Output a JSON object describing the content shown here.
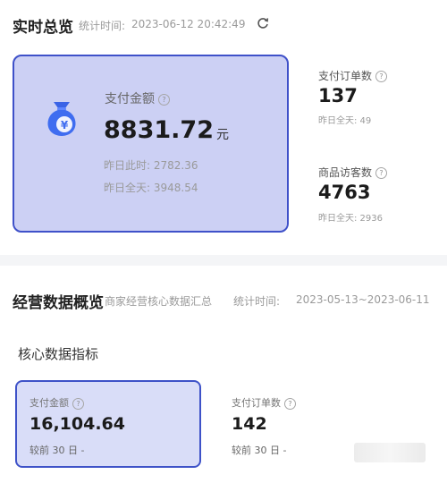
{
  "realtime": {
    "title": "实时总览",
    "stat_time_label": "统计时间:",
    "stat_time": "2023-06-12 20:42:49"
  },
  "main_card": {
    "label": "支付金额",
    "value": "8831.72",
    "unit": "元",
    "yesterday_same_time": "昨日此时: 2782.36",
    "yesterday_all_day": "昨日全天: 3948.54"
  },
  "side_metrics": [
    {
      "label": "支付订单数",
      "value": "137",
      "sub": "昨日全天: 49"
    },
    {
      "label": "商品访客数",
      "value": "4763",
      "sub": "昨日全天: 2936"
    }
  ],
  "overview": {
    "title": "经营数据概览",
    "description": "商家经营核心数据汇总",
    "stat_time_label": "统计时间:",
    "date_range": "2023-05-13~2023-06-11"
  },
  "core": {
    "title": "核心数据指标",
    "metrics": [
      {
        "label": "支付金额",
        "value": "16,104.64",
        "compare": "较前 30 日 -"
      },
      {
        "label": "支付订单数",
        "value": "142",
        "compare": "较前 30 日 -"
      }
    ]
  },
  "icons": {
    "question": "question-circle-icon",
    "refresh": "refresh-icon",
    "money_bag": "money-bag-icon"
  },
  "colors": {
    "accent": "#3f51c9",
    "card_bg": "#ccd0f4",
    "card2_bg": "#d9ddf8"
  }
}
